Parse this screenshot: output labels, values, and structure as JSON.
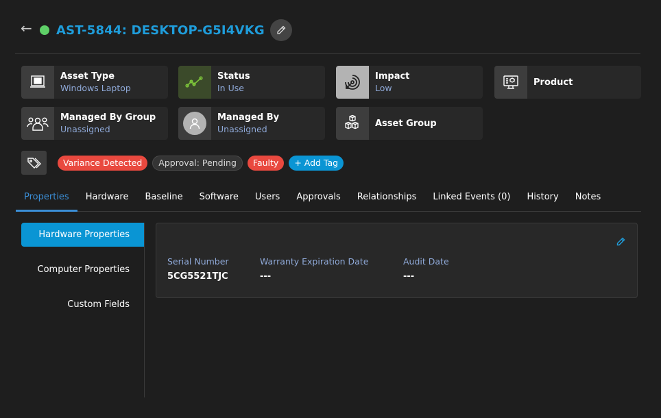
{
  "header": {
    "back_icon": "arrow-left-icon",
    "status_color": "#5fd068",
    "title": "AST-5844: DESKTOP-G5I4VKG",
    "edit_icon": "pencil-icon"
  },
  "cards": [
    {
      "label": "Asset Type",
      "value": "Windows Laptop",
      "icon": "windows-laptop-icon"
    },
    {
      "label": "Status",
      "value": "In Use",
      "icon": "trend-line-icon"
    },
    {
      "label": "Impact",
      "value": "Low",
      "icon": "target-icon"
    },
    {
      "label": "Product",
      "value": "",
      "icon": "monitor-product-icon"
    },
    {
      "label": "Managed By Group",
      "value": "Unassigned",
      "icon": "users-group-icon"
    },
    {
      "label": "Managed By",
      "value": "Unassigned",
      "icon": "user-avatar-icon"
    },
    {
      "label": "Asset Group",
      "value": "",
      "icon": "boxes-icon"
    }
  ],
  "tags": {
    "icon": "tags-icon",
    "items": [
      {
        "label": "Variance Detected",
        "color": "#e9493f"
      },
      {
        "label": "Approval: Pending",
        "color": "#343434"
      },
      {
        "label": "Faulty",
        "color": "#e9493f"
      }
    ],
    "add_label": "+ Add Tag"
  },
  "tabs": [
    {
      "label": "Properties",
      "active": true
    },
    {
      "label": "Hardware"
    },
    {
      "label": "Baseline"
    },
    {
      "label": "Software"
    },
    {
      "label": "Users"
    },
    {
      "label": "Approvals"
    },
    {
      "label": "Relationships"
    },
    {
      "label": "Linked Events (0)"
    },
    {
      "label": "History"
    },
    {
      "label": "Notes"
    }
  ],
  "subnav": [
    {
      "label": "Hardware Properties",
      "active": true
    },
    {
      "label": "Computer Properties"
    },
    {
      "label": "Custom Fields"
    }
  ],
  "panel": {
    "edit_icon": "pencil-icon",
    "fields": [
      {
        "label": "Serial Number",
        "value": "5CG5521TJC"
      },
      {
        "label": "Warranty Expiration Date",
        "value": "---"
      },
      {
        "label": "Audit Date",
        "value": "---"
      }
    ]
  },
  "colors": {
    "accent": "#0a95d4",
    "title": "#1f9ddb",
    "danger": "#e9493f",
    "muted_value": "#8fa9d8"
  }
}
